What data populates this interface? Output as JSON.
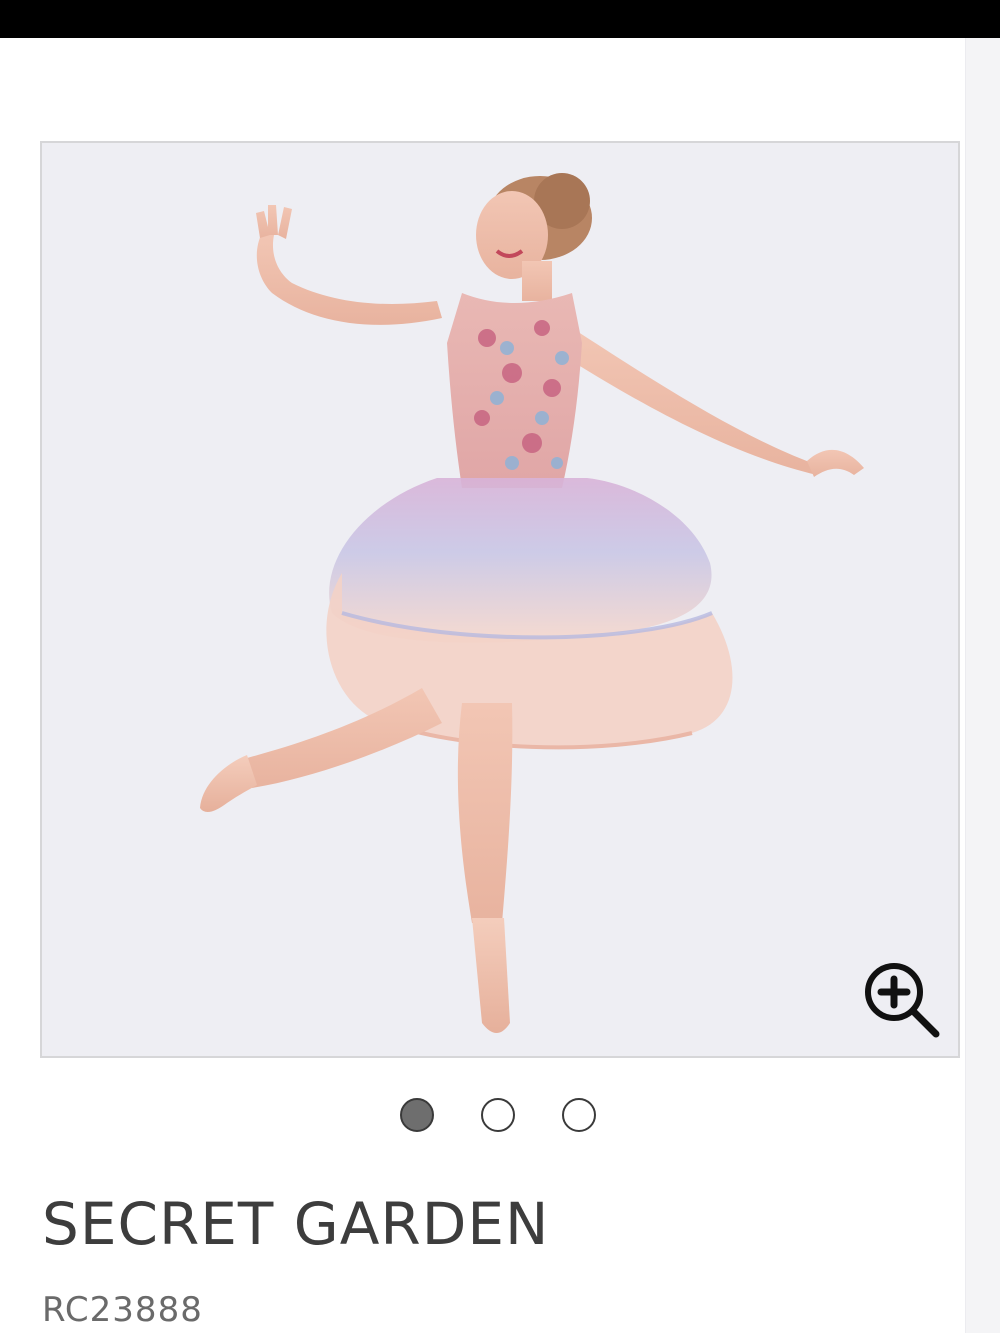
{
  "product": {
    "title": "SECRET GARDEN",
    "sku": "RC23888"
  },
  "gallery": {
    "image_count": 3,
    "active_index": 0,
    "zoom_icon": "zoom-in-icon"
  },
  "colors": {
    "top_bar": "#000000",
    "image_background": "#eeeef3",
    "dot_active": "#6e6e6e",
    "title_text": "#3d3d3d"
  }
}
